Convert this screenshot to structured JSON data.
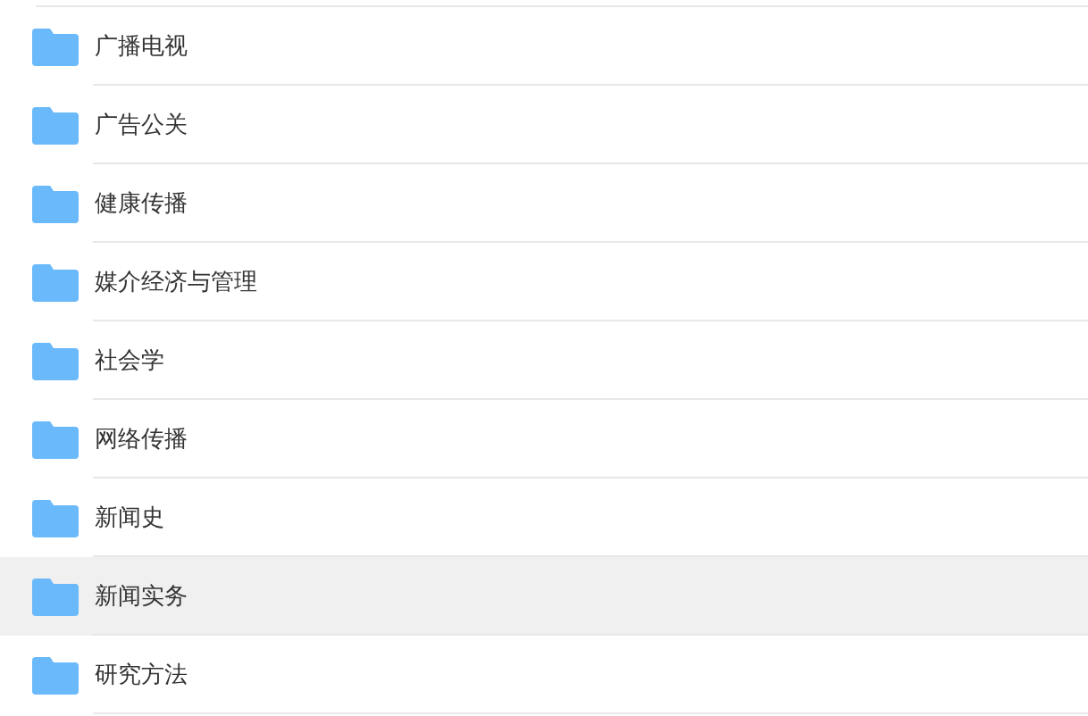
{
  "folders": [
    {
      "name": "广播电视",
      "selected": false
    },
    {
      "name": "广告公关",
      "selected": false
    },
    {
      "name": "健康传播",
      "selected": false
    },
    {
      "name": "媒介经济与管理",
      "selected": false
    },
    {
      "name": "社会学",
      "selected": false
    },
    {
      "name": "网络传播",
      "selected": false
    },
    {
      "name": "新闻史",
      "selected": false
    },
    {
      "name": "新闻实务",
      "selected": true
    },
    {
      "name": "研究方法",
      "selected": false
    }
  ]
}
